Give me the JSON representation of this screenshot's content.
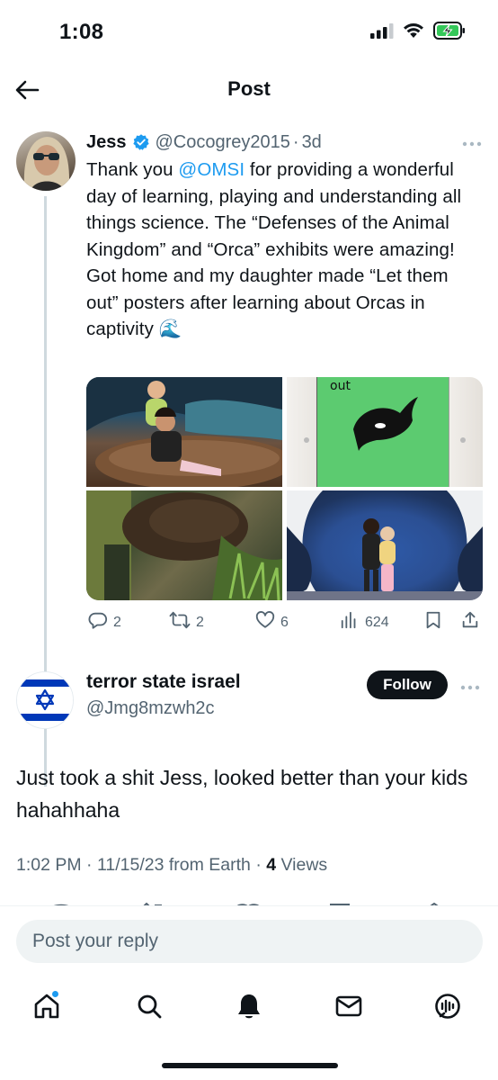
{
  "status_bar": {
    "time": "1:08",
    "icons": [
      "signal-icon",
      "wifi-icon",
      "battery-charging-icon"
    ],
    "battery_color": "#34c759"
  },
  "header": {
    "title": "Post",
    "back_icon": "back-arrow-icon"
  },
  "original_post": {
    "author_name": "Jess",
    "verified": true,
    "handle": "@Cocogrey2015",
    "separator": "·",
    "time_ago": "3d",
    "text_parts": {
      "before_mention": "Thank you ",
      "mention": "@OMSI",
      "after_mention": " for providing a wonderful day of learning, playing and understanding all things science. The “Defenses of the Animal Kingdom” and “Orca” exhibits were amazing! Got home and my daughter made “Let them out” posters after learning about Orcas in captivity 🌊"
    },
    "media_count": 4,
    "media_text": "out",
    "stats": {
      "replies": "2",
      "reposts": "2",
      "likes": "6",
      "views": "624"
    }
  },
  "reply_post": {
    "author_name": "terror state israel",
    "handle": "@Jmg8mzwh2c",
    "follow_label": "Follow",
    "text": "Just took a shit Jess, looked better than your kids hahahhaha",
    "meta": {
      "time": "1:02 PM",
      "date": "11/15/23",
      "source": "from Earth",
      "separator": "·",
      "views_count": "4",
      "views_label": "Views"
    }
  },
  "composer": {
    "placeholder": "Post your reply"
  },
  "bottom_nav": {
    "items": [
      "home-icon",
      "search-icon",
      "notifications-bell-icon",
      "messages-icon",
      "grok-icon"
    ]
  },
  "colors": {
    "accent": "#1d9bf0",
    "text": "#0f1419",
    "muted": "#536471",
    "flag_blue": "#0038b8"
  }
}
